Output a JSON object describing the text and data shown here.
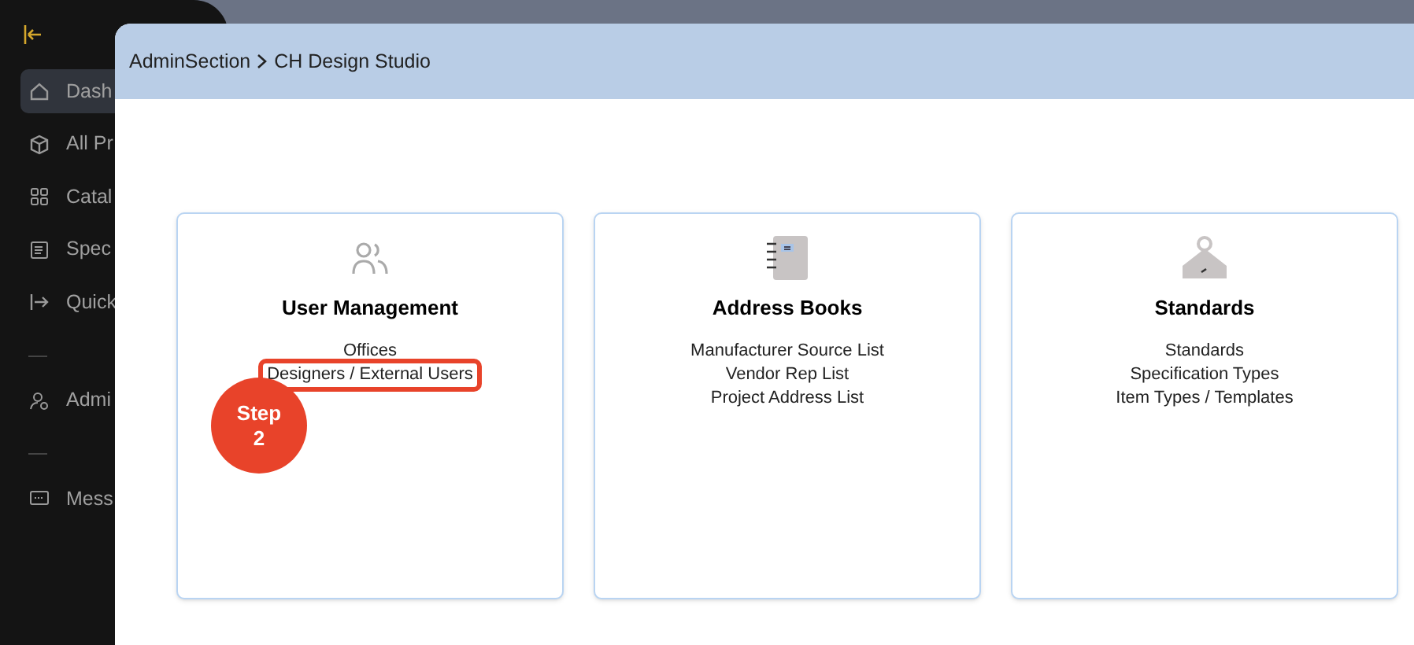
{
  "sidebar": {
    "items": [
      {
        "kind": "link",
        "label": "Dash",
        "selected": true
      },
      {
        "kind": "link",
        "label": "All Pr",
        "selected": false
      },
      {
        "kind": "link",
        "label": "Catal",
        "selected": false
      },
      {
        "kind": "link",
        "label": "Spec",
        "selected": false
      },
      {
        "kind": "link",
        "label": "Quick",
        "selected": false
      },
      {
        "kind": "divider"
      },
      {
        "kind": "link",
        "label": "Admi",
        "selected": false
      },
      {
        "kind": "divider"
      },
      {
        "kind": "link",
        "label": "Mess",
        "selected": false
      }
    ]
  },
  "dialog": {
    "breadcrumb": [
      "AdminSection",
      "CH Design Studio"
    ],
    "cards": [
      {
        "title": "User Management",
        "links": [
          {
            "label": "Offices",
            "highlighted": false
          },
          {
            "label": "Designers / External Users",
            "highlighted": true
          }
        ],
        "step": "Step 2"
      },
      {
        "title": "Address Books",
        "links": [
          {
            "label": "Manufacturer Source List",
            "highlighted": false
          },
          {
            "label": "Vendor Rep List",
            "highlighted": false
          },
          {
            "label": "Project Address List",
            "highlighted": false
          }
        ]
      },
      {
        "title": "Standards",
        "links": [
          {
            "label": "Standards",
            "highlighted": false
          },
          {
            "label": "Specification Types",
            "highlighted": false
          },
          {
            "label": "Item Types / Templates",
            "highlighted": false
          }
        ]
      }
    ]
  }
}
